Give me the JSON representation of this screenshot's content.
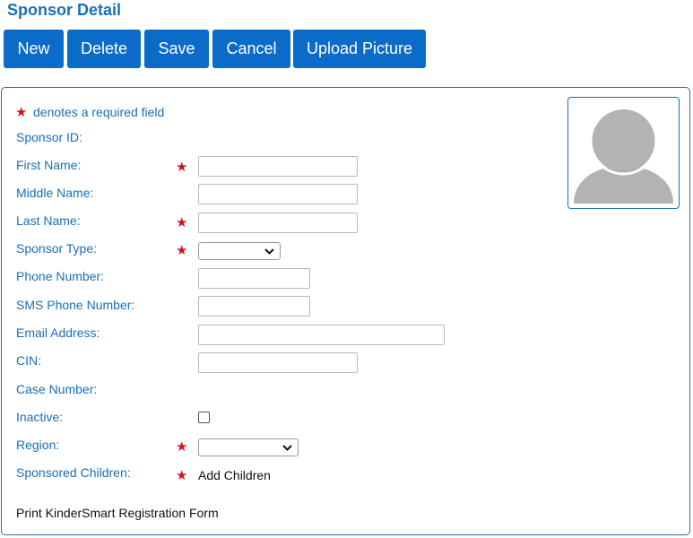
{
  "page": {
    "title": "Sponsor Detail"
  },
  "toolbar": {
    "new_label": "New",
    "delete_label": "Delete",
    "save_label": "Save",
    "cancel_label": "Cancel",
    "upload_label": "Upload Picture"
  },
  "colors": {
    "accent": "#0b6bc8",
    "label": "#1a6fb5",
    "required": "#d0161c"
  },
  "form": {
    "required_note": "denotes a required field",
    "sponsor_id_label": "Sponsor ID:",
    "first_name_label": "First Name:",
    "first_name_value": "",
    "middle_name_label": "Middle Name:",
    "middle_name_value": "",
    "last_name_label": "Last Name:",
    "last_name_value": "",
    "sponsor_type_label": "Sponsor Type:",
    "sponsor_type_value": "",
    "phone_label": "Phone Number:",
    "phone_value": "",
    "sms_phone_label": "SMS Phone Number:",
    "sms_phone_value": "",
    "email_label": "Email Address:",
    "email_value": "",
    "cin_label": "CIN:",
    "cin_value": "",
    "case_number_label": "Case Number:",
    "inactive_label": "Inactive:",
    "inactive_checked": false,
    "region_label": "Region:",
    "region_value": "",
    "sponsored_children_label": "Sponsored Children:",
    "add_children_label": "Add Children",
    "print_form_label": "Print KinderSmart Registration Form"
  },
  "photo": {
    "icon": "avatar-placeholder-icon"
  }
}
